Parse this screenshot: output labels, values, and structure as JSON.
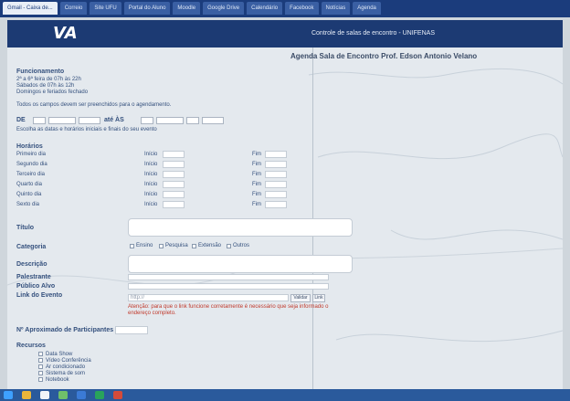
{
  "tabs": [
    "Gmail - Caixa de...",
    "Correio",
    "Site UFU",
    "Portal do Aluno",
    "Moodle",
    "Google Drive",
    "Calendário",
    "Facebook",
    "Notícias",
    "Agenda"
  ],
  "header": {
    "title": "Controle de salas de encontro - UNIFENAS"
  },
  "agenda": {
    "title": "Agenda Sala de Encontro Prof. Edson Antonio Velano"
  },
  "funcionamento": {
    "heading": "Funcionamento",
    "lines": [
      "2ª a 6ª feira de 07h às 22h",
      "Sábados de 07h às 12h",
      "Domingos e feriados fechado"
    ]
  },
  "note": "Todos os campos devem ser preenchidos para o agendamento.",
  "date_row": {
    "de_label": "DE",
    "ate_label": "até ÀS",
    "sub": "Escolha as datas e horários iniciais e finais do seu evento"
  },
  "horarios": {
    "heading": "Horários",
    "days": [
      "Primeiro dia",
      "Segundo dia",
      "Terceiro dia",
      "Quarto dia",
      "Quinto dia",
      "Sexto dia"
    ],
    "inicio_label": "Início",
    "fim_label": "Fim"
  },
  "form": {
    "titulo": "Título",
    "categoria": "Categoria",
    "categorias": [
      "Ensino",
      "Pesquisa",
      "Extensão",
      "Outros"
    ],
    "descricao": "Descrição",
    "palestrante": "Palestrante",
    "publico": "Público Alvo",
    "link": "Link do Evento",
    "link_placeholder": "http://",
    "validar": "Validar",
    "link_btn": "Link",
    "warning": "Atenção: para que o link funcione corretamente é necessário que seja informado o endereço completo.",
    "participantes": "Nº Aproximado de Participantes",
    "recursos": "Recursos",
    "recursos_items": [
      "Data Show",
      "Vídeo Conferência",
      "Ar condicionado",
      "Sistema de som",
      "Notebook"
    ]
  }
}
